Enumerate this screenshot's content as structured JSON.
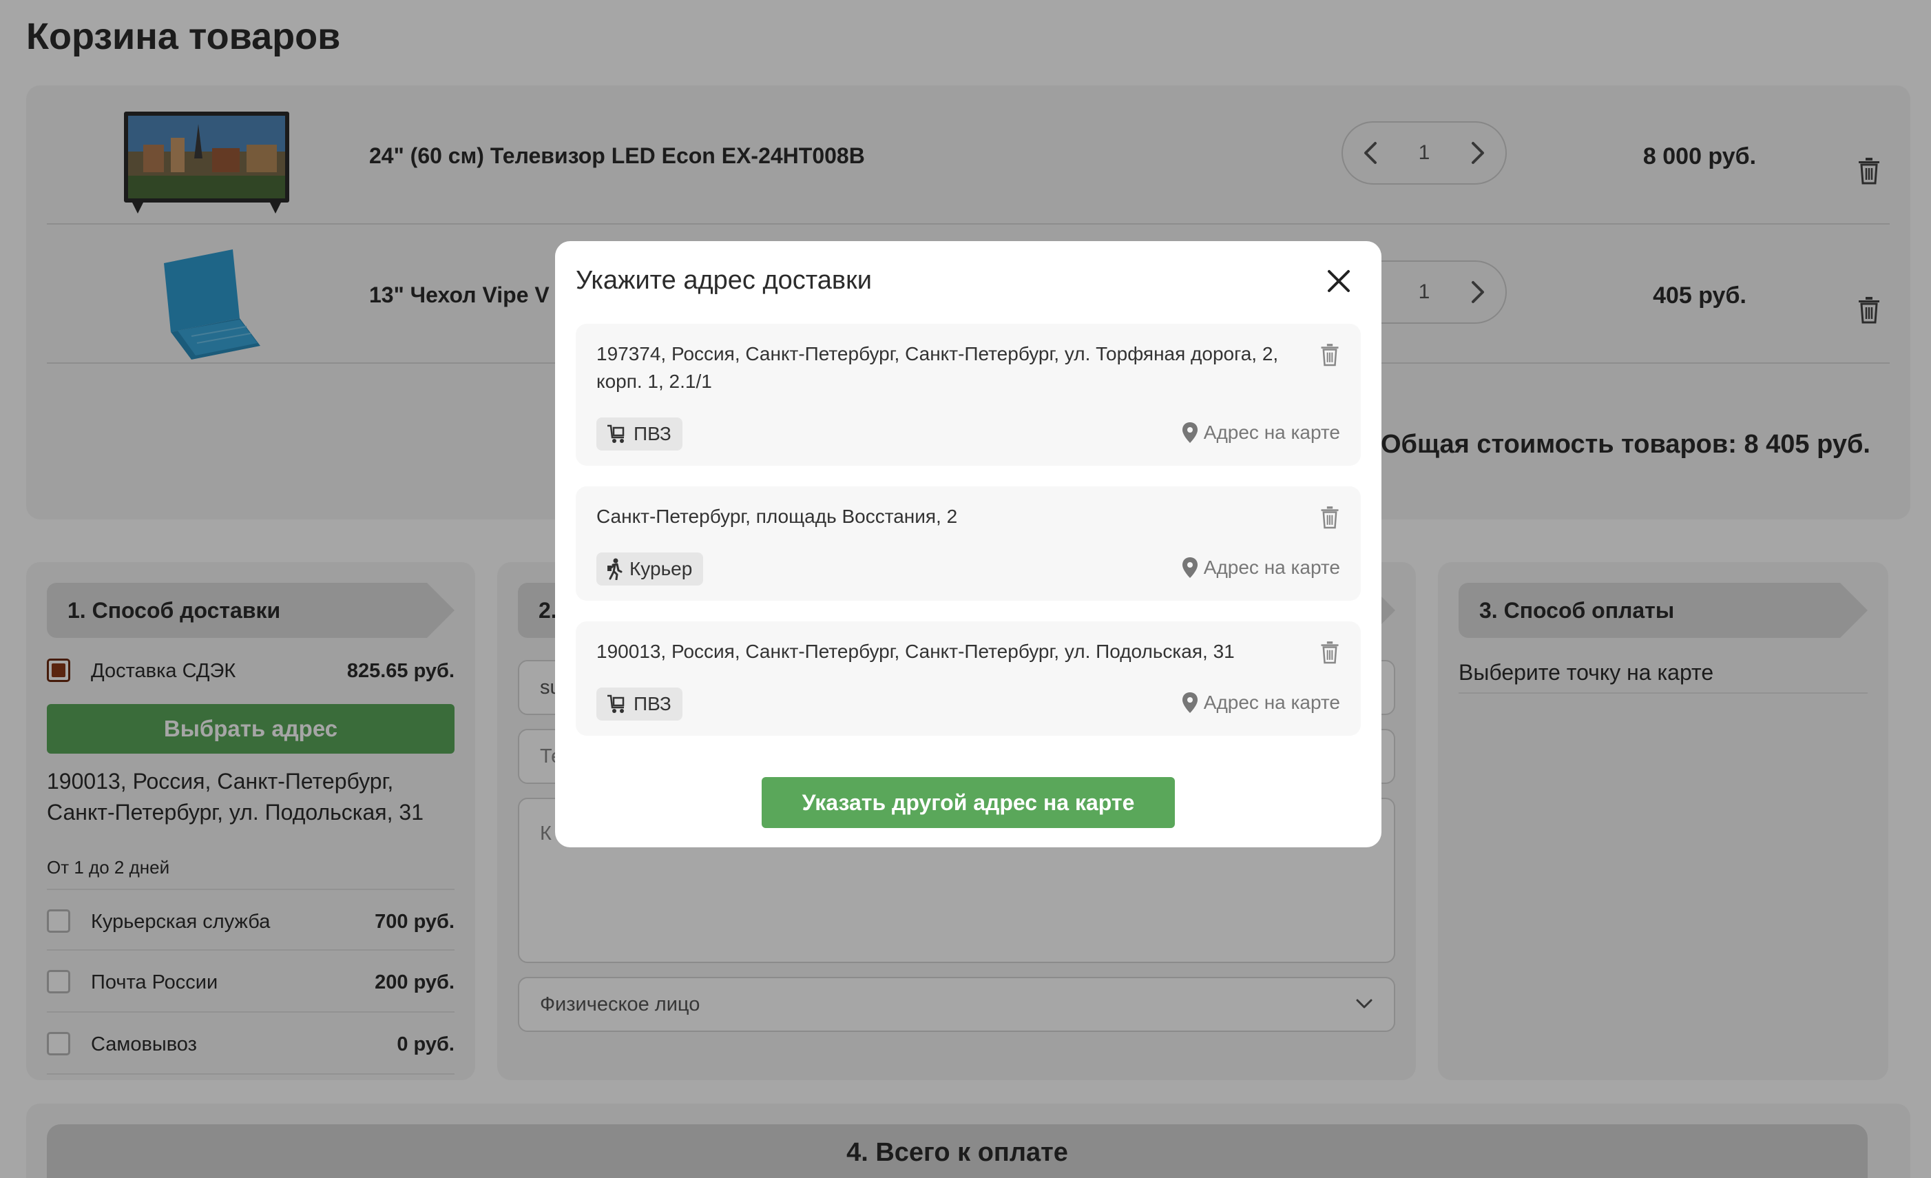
{
  "page": {
    "title": "Корзина товаров"
  },
  "cart": {
    "items": [
      {
        "name": "24\" (60 см) Телевизор LED Econ EX-24HT008B",
        "quantity": "1",
        "price": "8 000 руб.",
        "image_icon": "tv-thumbnail"
      },
      {
        "name": "13\" Чехол Vipe V",
        "quantity": "1",
        "price": "405 руб.",
        "image_icon": "laptop-case-thumbnail"
      }
    ],
    "total": "Общая стоимость товаров: 8 405 руб."
  },
  "delivery": {
    "heading": "1. Способ доставки",
    "options": [
      {
        "label": "Доставка СДЭК",
        "price": "825.65 руб.",
        "checked": true
      },
      {
        "label": "Курьерская служба",
        "price": "700 руб.",
        "checked": false
      },
      {
        "label": "Почта России",
        "price": "200 руб.",
        "checked": false
      },
      {
        "label": "Самовывоз",
        "price": "0 руб.",
        "checked": false
      }
    ],
    "choose_address_label": "Выбрать адрес",
    "selected_address": "190013, Россия, Санкт-Петербург, Санкт-Петербург, ул. Подольская, 31",
    "term": "От 1 до 2 дней"
  },
  "recipient": {
    "heading": "2.",
    "field_email_value": "su",
    "field_phone_value": "Те",
    "comment_placeholder": "К",
    "person_type": "Физическое лицо"
  },
  "payment": {
    "heading": "3. Способ оплаты",
    "hint": "Выберите точку на карте"
  },
  "summary": {
    "heading": "4. Всего к оплате"
  },
  "modal": {
    "title": "Укажите адрес доставки",
    "addresses": [
      {
        "text": "197374, Россия, Санкт-Петербург, Санкт-Петербург, ул. Торфяная дорога, 2, корп. 1, 2.1/1",
        "type": "ПВЗ",
        "map_link": "Адрес на карте"
      },
      {
        "text": "Санкт-Петербург, площадь Восстания, 2",
        "type": "Курьер",
        "map_link": "Адрес на карте"
      },
      {
        "text": "190013, Россия, Санкт-Петербург, Санкт-Петербург, ул. Подольская, 31",
        "type": "ПВЗ",
        "map_link": "Адрес на карте"
      }
    ],
    "other_address_label": "Указать другой адрес на карте"
  },
  "colors": {
    "accent_green": "#5aa75a",
    "overlay": "rgba(0,0,0,0.35)",
    "checkbox_checked": "#8b3a1a"
  }
}
